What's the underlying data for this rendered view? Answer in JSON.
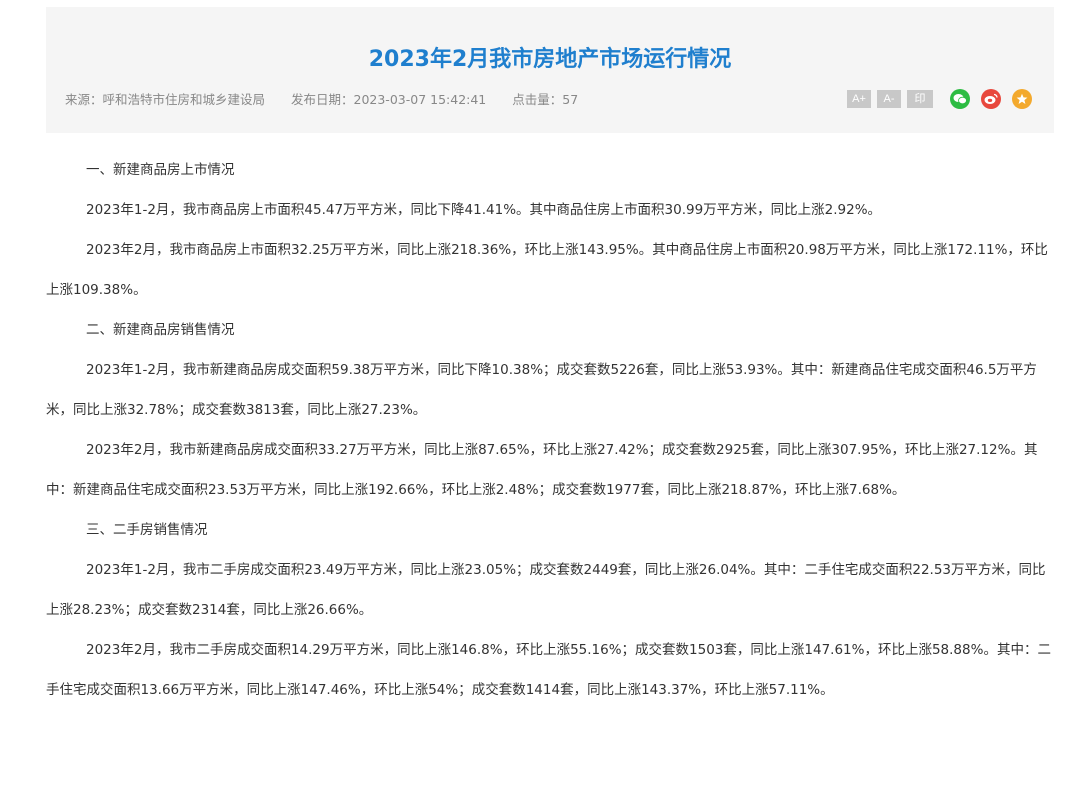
{
  "article": {
    "title": "2023年2月我市房地产市场运行情况",
    "meta": {
      "source": "来源：呼和浩特市住房和城乡建设局",
      "date": "发布日期：2023-03-07 15:42:41",
      "views": "点击量：57"
    },
    "tools": {
      "font_increase": "A+",
      "font_decrease": "A-",
      "print": "印"
    },
    "share_icons": [
      "wechat-icon",
      "weibo-icon",
      "qzone-icon"
    ],
    "colors": {
      "title": "#1f7fce",
      "wechat": "#2dbc43",
      "weibo": "#e8483d",
      "qzone": "#f3a92d"
    },
    "paragraphs": [
      "一、新建商品房上市情况",
      "2023年1-2月，我市商品房上市面积45.47万平方米，同比下降41.41%。其中商品住房上市面积30.99万平方米，同比上涨2.92%。",
      "2023年2月，我市商品房上市面积32.25万平方米，同比上涨218.36%，环比上涨143.95%。其中商品住房上市面积20.98万平方米，同比上涨172.11%，环比上涨109.38%。",
      "二、新建商品房销售情况",
      "2023年1-2月，我市新建商品房成交面积59.38万平方米，同比下降10.38%；成交套数5226套，同比上涨53.93%。其中：新建商品住宅成交面积46.5万平方米，同比上涨32.78%；成交套数3813套，同比上涨27.23%。",
      "2023年2月，我市新建商品房成交面积33.27万平方米，同比上涨87.65%，环比上涨27.42%；成交套数2925套，同比上涨307.95%，环比上涨27.12%。其中：新建商品住宅成交面积23.53万平方米，同比上涨192.66%，环比上涨2.48%；成交套数1977套，同比上涨218.87%，环比上涨7.68%。",
      "三、二手房销售情况",
      "2023年1-2月，我市二手房成交面积23.49万平方米，同比上涨23.05%；成交套数2449套，同比上涨26.04%。其中：二手住宅成交面积22.53万平方米，同比上涨28.23%；成交套数2314套，同比上涨26.66%。",
      "2023年2月，我市二手房成交面积14.29万平方米，同比上涨146.8%，环比上涨55.16%；成交套数1503套，同比上涨147.61%，环比上涨58.88%。其中：二手住宅成交面积13.66万平方米，同比上涨147.46%，环比上涨54%；成交套数1414套，同比上涨143.37%，环比上涨57.11%。"
    ]
  }
}
